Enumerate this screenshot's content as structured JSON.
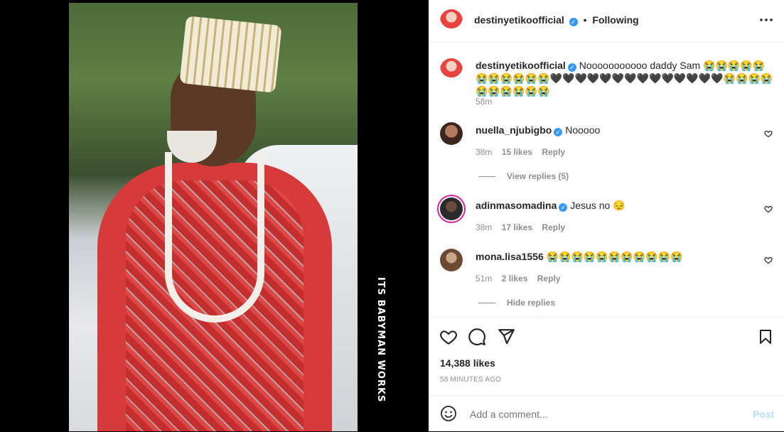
{
  "post": {
    "watermark_line1": "ITS",
    "watermark_line2": "BABYMAN WORKS"
  },
  "header": {
    "username": "destinyetikoofficial",
    "separator": "•",
    "follow_status": "Following",
    "more_icon": "more-horizontal-icon"
  },
  "caption": {
    "username": "destinyetikoofficial",
    "text": "Nooooooooooo daddy Sam 😭😭😭😭😭😭😭😭😭😭😭🖤🖤🖤🖤🖤🖤🖤🖤🖤🖤🖤🖤🖤🖤😭😭😭😭😭😭😭😭😭😭",
    "time": "58m"
  },
  "comments": [
    {
      "username": "nuella_njubigbo",
      "verified": true,
      "text": "Nooooo",
      "time": "38m",
      "likes": "15 likes",
      "reply": "Reply",
      "thread": "View replies (5)"
    },
    {
      "username": "adinmasomadina",
      "verified": true,
      "text": "Jesus no 😔",
      "time": "38m",
      "likes": "17 likes",
      "reply": "Reply"
    },
    {
      "username": "mona.lisa1556",
      "verified": false,
      "text": "😭😭😭😭😭😭😭😭😭😭😭",
      "time": "51m",
      "likes": "2 likes",
      "reply": "Reply",
      "thread": "Hide replies"
    }
  ],
  "actions": {
    "likes": "14,388 likes",
    "timestamp": "58 MINUTES AGO"
  },
  "add_comment": {
    "placeholder": "Add a comment...",
    "post_label": "Post"
  },
  "colors": {
    "verified": "#3897f0",
    "post_button": "#b2dffc",
    "muted": "#8e8e8e"
  }
}
